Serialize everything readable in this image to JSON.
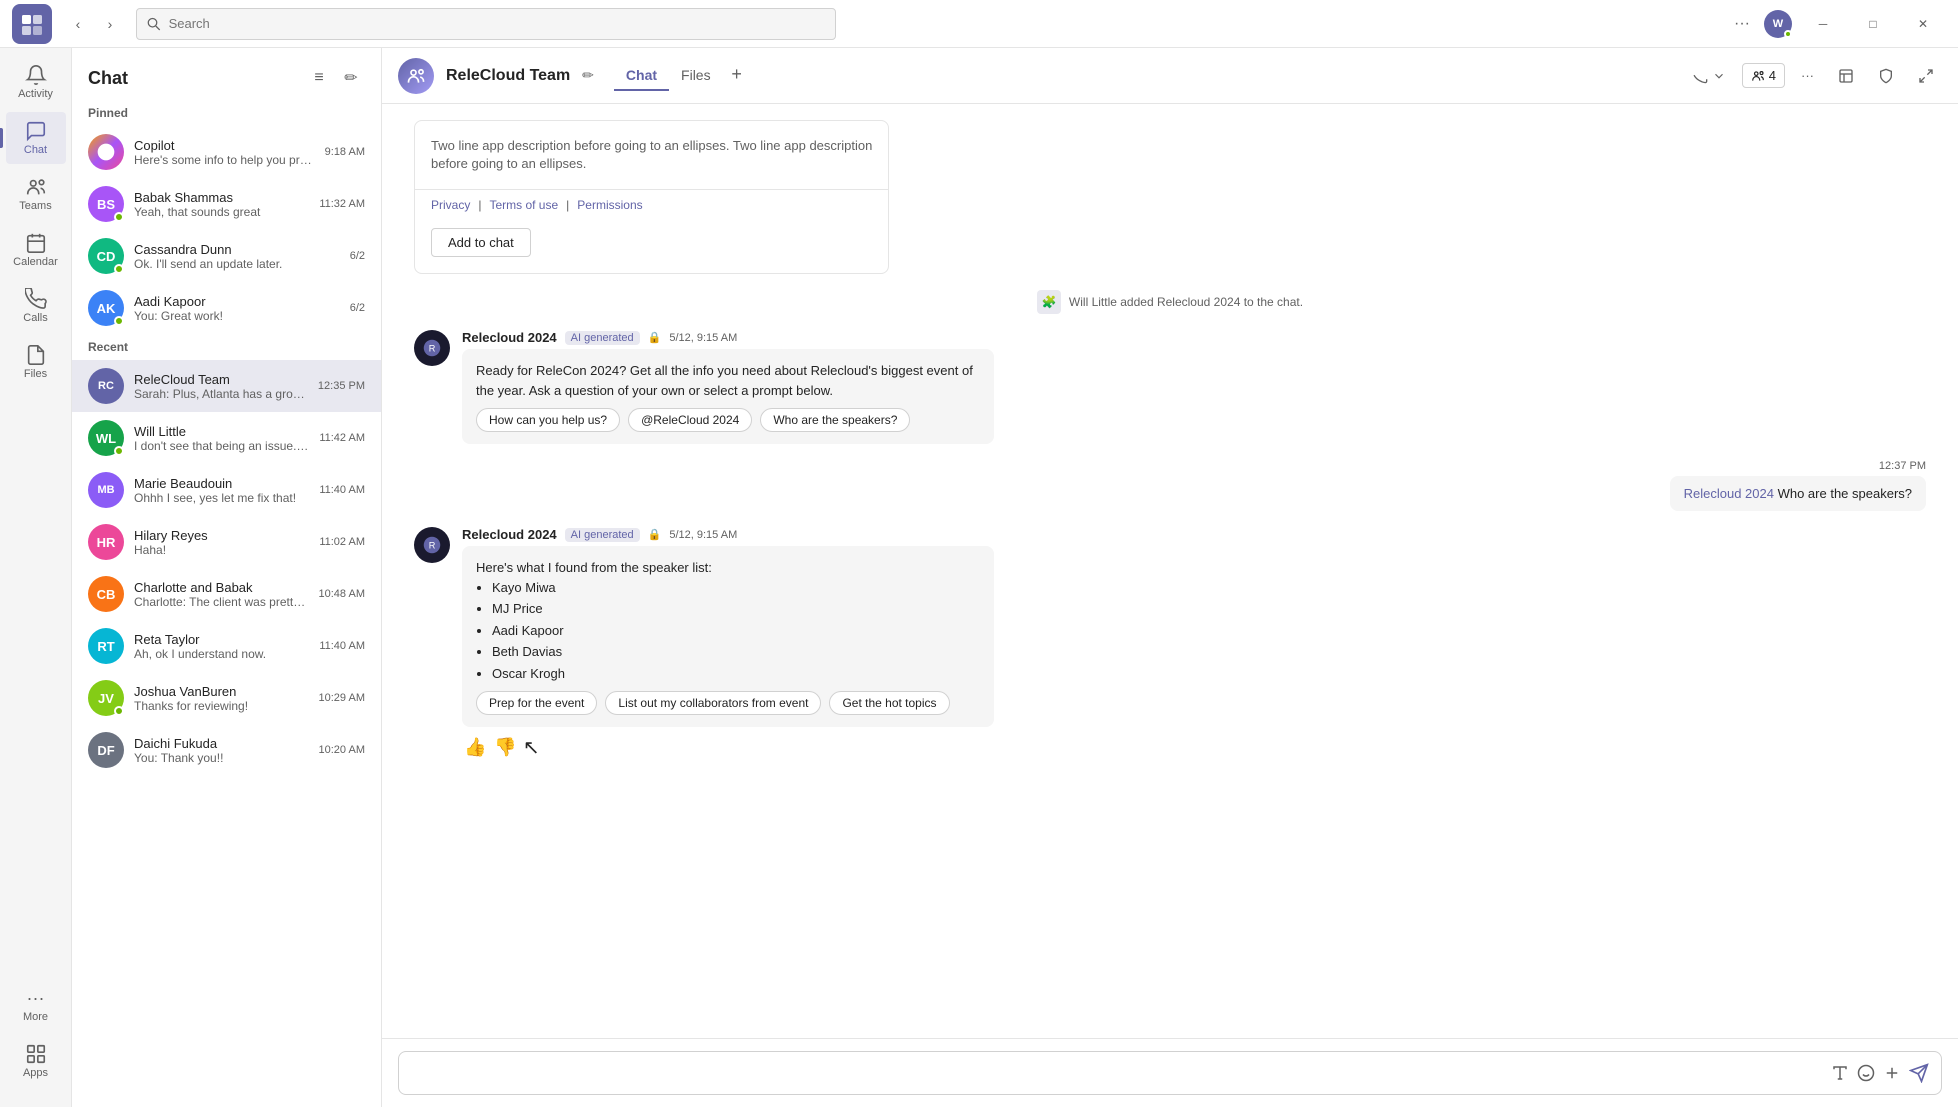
{
  "app": {
    "title": "Microsoft Teams",
    "logo_text": "T"
  },
  "titlebar": {
    "back_label": "‹",
    "forward_label": "›",
    "search_placeholder": "Search",
    "more_label": "···",
    "minimize_label": "─",
    "maximize_label": "□",
    "close_label": "✕"
  },
  "sidebar": {
    "items": [
      {
        "id": "activity",
        "label": "Activity",
        "icon": "bell"
      },
      {
        "id": "chat",
        "label": "Chat",
        "icon": "chat",
        "active": true
      },
      {
        "id": "teams",
        "label": "Teams",
        "icon": "teams"
      },
      {
        "id": "calendar",
        "label": "Calendar",
        "icon": "calendar"
      },
      {
        "id": "calls",
        "label": "Calls",
        "icon": "phone"
      },
      {
        "id": "files",
        "label": "Files",
        "icon": "files"
      }
    ],
    "bottom_items": [
      {
        "id": "more",
        "label": "···"
      },
      {
        "id": "apps",
        "label": "Apps"
      }
    ]
  },
  "chat_list": {
    "title": "Chat",
    "filter_label": "≡",
    "new_chat_label": "✏",
    "pinned_label": "Pinned",
    "pinned_items": [
      {
        "name": "Copilot",
        "preview": "Here's some info to help you prep for your...",
        "time": "9:18 AM",
        "avatar_color": "#f0c040",
        "initials": "C"
      },
      {
        "name": "Babak Shammas",
        "preview": "Yeah, that sounds great",
        "time": "11:32 AM",
        "avatar_color": "#a855f7",
        "initials": "BS",
        "online": true
      },
      {
        "name": "Cassandra Dunn",
        "preview": "Ok. I'll send an update later.",
        "time": "6/2",
        "avatar_color": "#10b981",
        "initials": "CD",
        "online": true
      },
      {
        "name": "Aadi Kapoor",
        "preview": "You: Great work!",
        "time": "6/2",
        "avatar_color": "#3b82f6",
        "initials": "AK",
        "online": true
      }
    ],
    "recent_label": "Recent",
    "recent_items": [
      {
        "name": "ReleCloud Team",
        "preview": "Sarah: Plus, Atlanta has a growing tech ...",
        "time": "12:35 PM",
        "avatar_color": "#6264a7",
        "initials": "RC",
        "active": true
      },
      {
        "name": "Will Little",
        "preview": "I don't see that being an issue. Can you ta...",
        "time": "11:42 AM",
        "avatar_color": "#16a34a",
        "initials": "WL",
        "online": true
      },
      {
        "name": "Marie Beaudouin",
        "preview": "Ohhh I see, yes let me fix that!",
        "time": "11:40 AM",
        "avatar_color": "#8b5cf6",
        "initials": "MB"
      },
      {
        "name": "Hilary Reyes",
        "preview": "Haha!",
        "time": "11:02 AM",
        "avatar_color": "#ec4899",
        "initials": "HR"
      },
      {
        "name": "Charlotte and Babak",
        "preview": "Charlotte: The client was pretty happy with...",
        "time": "10:48 AM",
        "avatar_color": "#f97316",
        "initials": "CB"
      },
      {
        "name": "Reta Taylor",
        "preview": "Ah, ok I understand now.",
        "time": "11:40 AM",
        "avatar_color": "#06b6d4",
        "initials": "RT"
      },
      {
        "name": "Joshua VanBuren",
        "preview": "Thanks for reviewing!",
        "time": "10:29 AM",
        "avatar_color": "#84cc16",
        "initials": "JV",
        "online": true
      },
      {
        "name": "Daichi Fukuda",
        "preview": "You: Thank you!!",
        "time": "10:20 AM",
        "avatar_color": "#6b7280",
        "initials": "DF"
      }
    ]
  },
  "chat_main": {
    "header": {
      "name": "ReleCloud Team",
      "tabs": [
        "Chat",
        "Files"
      ],
      "active_tab": "Chat",
      "add_tab_label": "+",
      "call_label": "📞",
      "participants_count": "4",
      "more_label": "···",
      "edit_icon": "✏"
    },
    "messages": {
      "app_card": {
        "description_line1": "Two line app description before going to an ellipses. Two line app description",
        "description_line2": "before going to an ellipses.",
        "link_privacy": "Privacy",
        "link_terms": "Terms of use",
        "link_permissions": "Permissions",
        "add_button": "Add to chat"
      },
      "system_msg": "Will Little added Relecloud 2024 to the chat.",
      "bot_msg_1": {
        "sender": "Relecloud 2024",
        "ai_badge": "AI generated",
        "time": "5/12, 9:15 AM",
        "text": "Ready for ReleCon 2024? Get all the info you need about Relecloud's biggest event of the year. Ask a question of your own or select a prompt below.",
        "chips": [
          "How can you help us?",
          "@ReleCloud 2024",
          "Who are the speakers?"
        ]
      },
      "user_msg": {
        "time": "12:37 PM",
        "ref": "Relecloud 2024",
        "text": "Who are the speakers?"
      },
      "bot_msg_2": {
        "sender": "Relecloud 2024",
        "ai_badge": "AI generated",
        "time": "5/12, 9:15 AM",
        "intro": "Here's what I found from the speaker list:",
        "speakers": [
          "Kayo Miwa",
          "MJ Price",
          "Aadi Kapoor",
          "Beth Davias",
          "Oscar Krogh"
        ],
        "chips": [
          "Prep for the event",
          "List out my collaborators from event",
          "Get the hot topics"
        ]
      }
    },
    "input": {
      "placeholder": "",
      "format_icon": "A",
      "emoji_icon": "☺",
      "attach_icon": "+",
      "send_icon": "➤"
    }
  }
}
